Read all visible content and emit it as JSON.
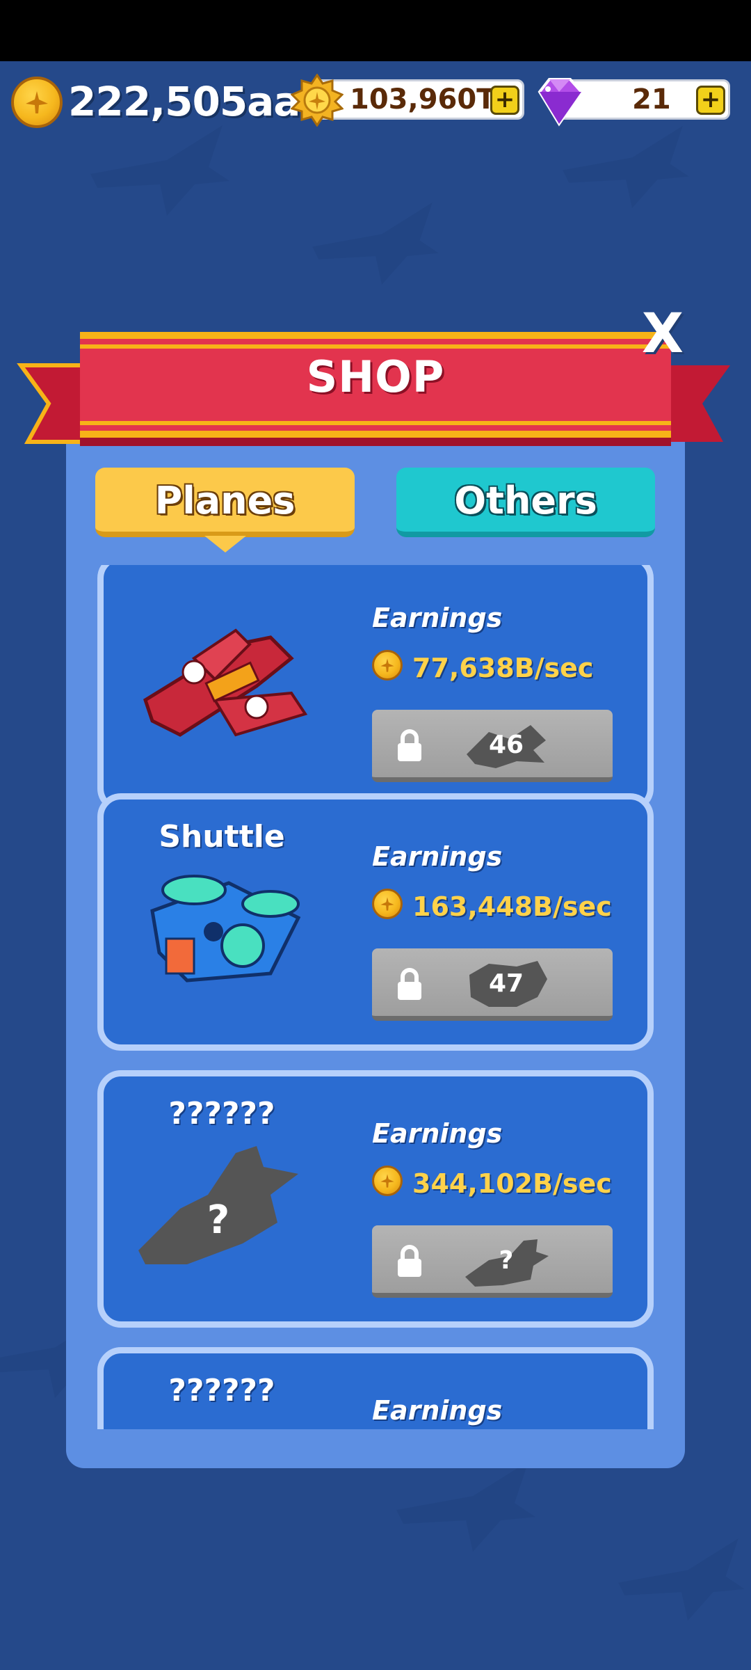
{
  "currency": {
    "gold_amount": "222,505aa",
    "medals_amount": "103,960T",
    "gems_amount": "21",
    "plus_label": "+"
  },
  "shop": {
    "title": "SHOP",
    "close_label": "X",
    "tabs": [
      {
        "label": "Planes",
        "active": true
      },
      {
        "label": "Others",
        "active": false
      }
    ],
    "cards": [
      {
        "name": "",
        "earnings_label": "Earnings",
        "rate": "77,638B/sec",
        "unlock_level": "46",
        "color": "#c8283a"
      },
      {
        "name": "Shuttle",
        "earnings_label": "Earnings",
        "rate": "163,448B/sec",
        "unlock_level": "47",
        "color": "#2fc9c0"
      },
      {
        "name": "??????",
        "earnings_label": "Earnings",
        "rate": "344,102B/sec",
        "unlock_level": "?",
        "color": "#6b6b6b"
      },
      {
        "name": "??????",
        "earnings_label": "Earnings",
        "rate": "",
        "unlock_level": "",
        "color": "#6b6b6b"
      }
    ]
  },
  "colors": {
    "background": "#25498a",
    "panel": "#5d8fe3",
    "card": "#2b6cd1",
    "ribbon": "#e2344e",
    "rate_text": "#ffd24a"
  },
  "icons": {
    "gold": "gold-coin-icon",
    "medal": "medal-icon",
    "gem": "gem-icon",
    "lock": "lock-icon"
  }
}
